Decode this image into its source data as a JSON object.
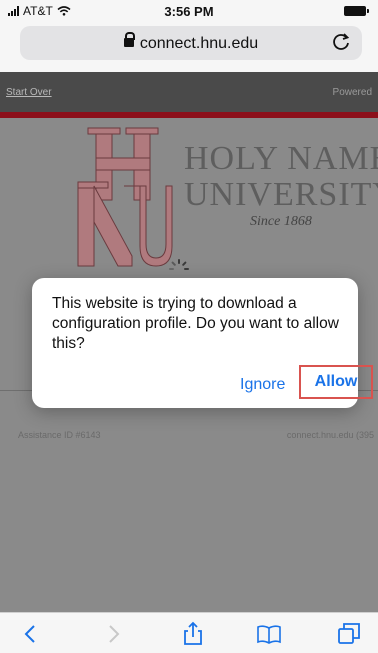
{
  "status_bar": {
    "carrier": "AT&T",
    "time": "3:56 PM"
  },
  "browser": {
    "url": "connect.hnu.edu"
  },
  "page": {
    "start_over": "Start Over",
    "powered": "Powered",
    "logo_line1": "HOLY NAMES",
    "logo_line2": "UNIVERSITY",
    "logo_since": "Since 1868",
    "assistance_id": "Assistance ID #6143",
    "host_code": "connect.hnu.edu (395"
  },
  "dialog": {
    "message": "This website is trying to download a configuration profile. Do you want to allow this?",
    "ignore_label": "Ignore",
    "allow_label": "Allow"
  },
  "toolbar": {
    "items": [
      "back-icon",
      "forward-icon",
      "share-icon",
      "bookmarks-icon",
      "tabs-icon"
    ]
  },
  "colors": {
    "accent": "#1a73e8",
    "brand_red": "#8c0f1a",
    "highlight": "#d9534f"
  }
}
